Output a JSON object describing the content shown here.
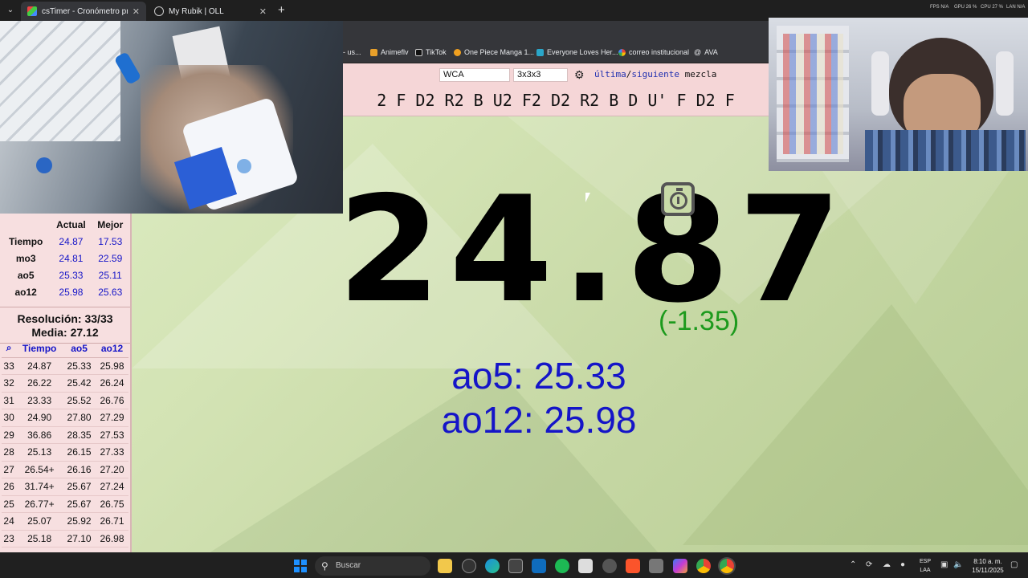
{
  "browser": {
    "tabs": [
      {
        "title": "csTimer - Cronómetro profesio",
        "active": true
      },
      {
        "title": "My Rubik | OLL",
        "active": false
      }
    ],
    "bookmarks": [
      "- us...",
      "Animeflv",
      "TikTok",
      "One Piece Manga 1...",
      "Everyone Loves Her...",
      "correo institucional",
      "AVA"
    ],
    "sys_stats": [
      "FPS N/A",
      "GPU 26 %",
      "CPU 27 %",
      "LAN N/A"
    ]
  },
  "timer": {
    "event_type": "WCA",
    "puzzle": "3x3x3",
    "next_links": {
      "last": "última",
      "next": "siguiente",
      "label": "mezcla"
    },
    "scramble": "2 F D2 R2 B U2 F2 D2 R2 B D U' F D2 F",
    "time": "24.87",
    "diff": "(-1.35)",
    "ao5_line": "ao5: 25.33",
    "ao12_line": "ao12: 25.98"
  },
  "stats": {
    "headers": [
      "",
      "Actual",
      "Mejor"
    ],
    "rows": [
      {
        "label": "Tiempo",
        "current": "24.87",
        "best": "17.53"
      },
      {
        "label": "mo3",
        "current": "24.81",
        "best": "22.59"
      },
      {
        "label": "ao5",
        "current": "25.33",
        "best": "25.11"
      },
      {
        "label": "ao12",
        "current": "25.98",
        "best": "25.63"
      }
    ],
    "resolution": "Resolución: 33/33",
    "mean": "Media: 27.12"
  },
  "times": {
    "headers": [
      "⌕",
      "Tiempo",
      "ao5",
      "ao12"
    ],
    "rows": [
      [
        "33",
        "24.87",
        "25.33",
        "25.98"
      ],
      [
        "32",
        "26.22",
        "25.42",
        "26.24"
      ],
      [
        "31",
        "23.33",
        "25.52",
        "26.76"
      ],
      [
        "30",
        "24.90",
        "27.80",
        "27.29"
      ],
      [
        "29",
        "36.86",
        "28.35",
        "27.53"
      ],
      [
        "28",
        "25.13",
        "26.15",
        "27.33"
      ],
      [
        "27",
        "26.54+",
        "26.16",
        "27.20"
      ],
      [
        "26",
        "31.74+",
        "25.67",
        "27.24"
      ],
      [
        "25",
        "26.77+",
        "25.67",
        "26.75"
      ],
      [
        "24",
        "25.07",
        "25.92",
        "26.71"
      ],
      [
        "23",
        "25.18",
        "27.10",
        "26.98"
      ]
    ]
  },
  "taskbar": {
    "search_placeholder": "Buscar",
    "language": [
      "ESP",
      "LAA"
    ],
    "time": "8:10 a. m.",
    "date": "15/11/2025"
  },
  "colors": {
    "accent_blue": "#1515c8",
    "diff_green": "#1d9a1d",
    "panel_pink": "#f7dfe0"
  }
}
